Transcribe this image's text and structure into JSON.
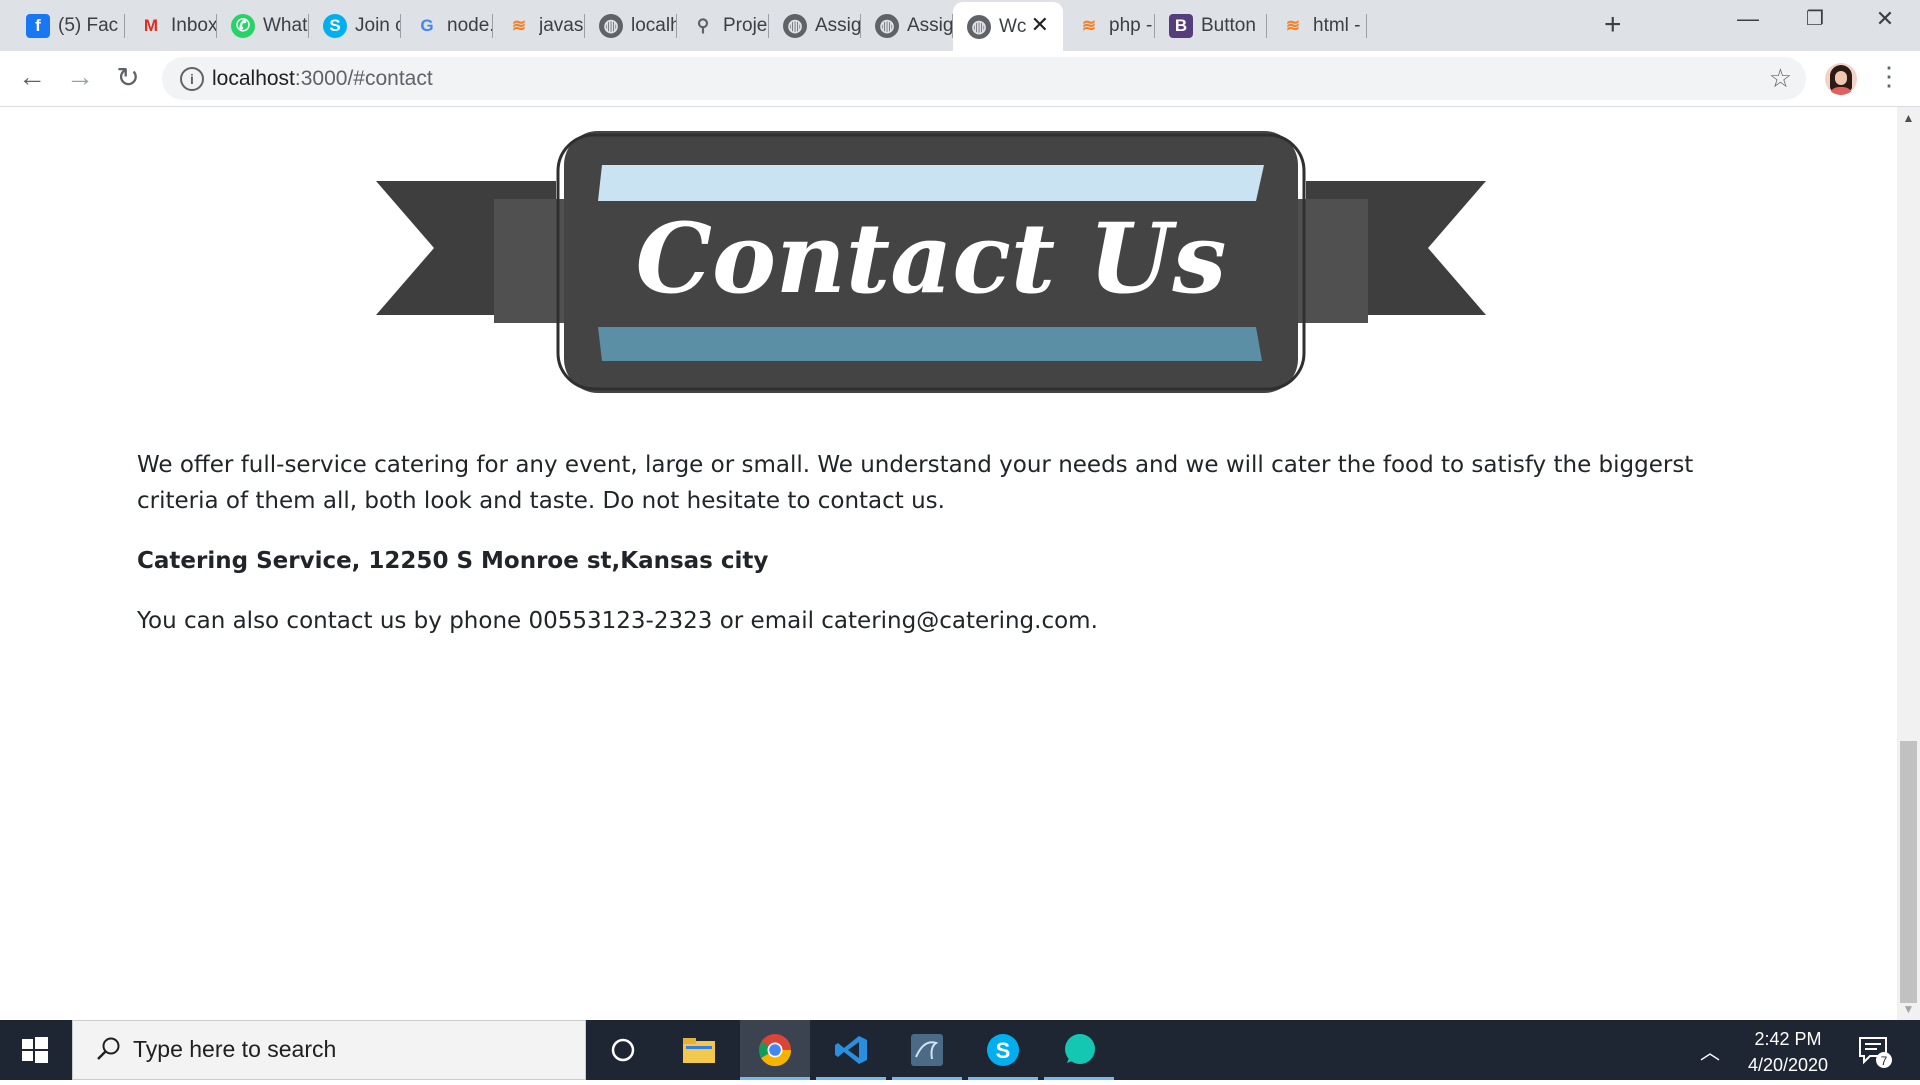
{
  "tabs": [
    {
      "title": "(5) Fac",
      "icon": "facebook-icon"
    },
    {
      "title": "Inbox (",
      "icon": "gmail-icon"
    },
    {
      "title": "Whats",
      "icon": "whatsapp-icon"
    },
    {
      "title": "Join cc",
      "icon": "skype-icon"
    },
    {
      "title": "node.js",
      "icon": "google-icon"
    },
    {
      "title": "javascr",
      "icon": "stackoverflow-icon"
    },
    {
      "title": "localho",
      "icon": "globe-icon"
    },
    {
      "title": "Project",
      "icon": "pin-icon"
    },
    {
      "title": "Assign",
      "icon": "globe-icon"
    },
    {
      "title": "Assign",
      "icon": "globe-icon"
    },
    {
      "title": "Wc",
      "icon": "globe-icon",
      "active": true
    },
    {
      "title": "php - l",
      "icon": "stackoverflow-icon"
    },
    {
      "title": "Button",
      "icon": "bootstrap-icon"
    },
    {
      "title": "html -",
      "icon": "stackoverflow-icon"
    }
  ],
  "address_bar": {
    "host": "localhost",
    "rest": ":3000/#contact"
  },
  "page": {
    "banner_text": "Contact Us",
    "intro": "We offer full-service catering for any event, large or small. We understand your needs and we will cater the food to satisfy the biggerst criteria of them all, both look and taste. Do not hesitate to contact us.",
    "address": "Catering Service, 12250 S Monroe st,Kansas city",
    "contact": "You can also contact us by phone 00553123-2323 or email catering@catering.com."
  },
  "taskbar": {
    "search_placeholder": "Type here to search",
    "time": "2:42 PM",
    "date": "4/20/2020",
    "notification_count": "7"
  },
  "colors": {
    "banner_dark": "#424242",
    "banner_light_blue": "#c9e3f2",
    "banner_teal": "#5a8fa6",
    "taskbar": "#1f2633"
  }
}
